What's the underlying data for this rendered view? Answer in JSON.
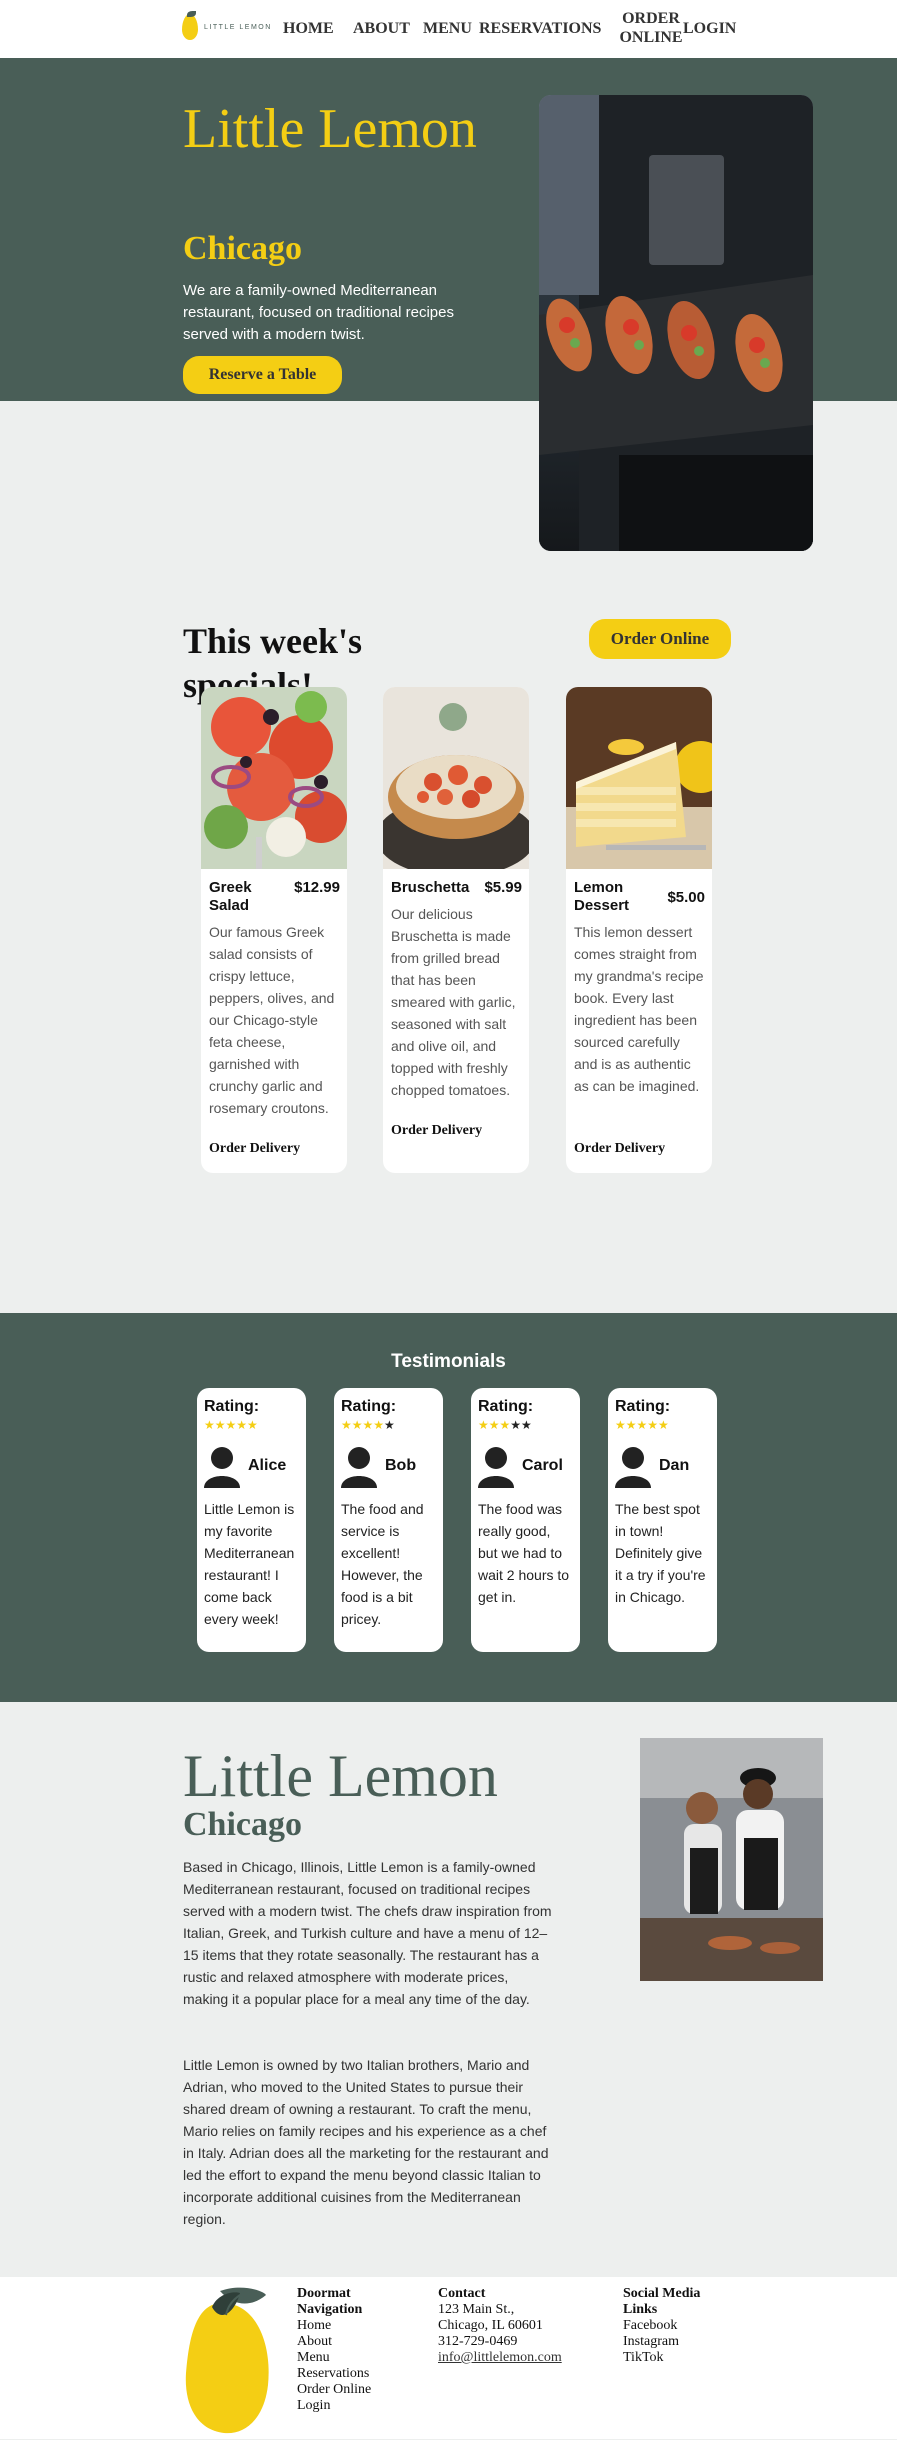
{
  "nav": {
    "logo_text": "LITTLE LEMON",
    "links": [
      {
        "label": "HOME"
      },
      {
        "label": "ABOUT"
      },
      {
        "label": "MENU"
      },
      {
        "label": "RESERVATIONS"
      },
      {
        "label": "ORDER ONLINE"
      },
      {
        "label": "LOGIN"
      }
    ]
  },
  "hero": {
    "title": "Little Lemon",
    "subtitle": "Chicago",
    "description": "We are a family-owned Mediterranean restaurant, focused on traditional recipes served with a modern twist.",
    "button": "Reserve a Table"
  },
  "specials": {
    "title": "This week's specials!",
    "order_button": "Order Online",
    "items": [
      {
        "name": "Greek Salad",
        "price": "$12.99",
        "description": "Our famous Greek salad consists of crispy lettuce, peppers, olives, and our Chicago-style feta cheese, garnished with crunchy garlic and rosemary croutons.",
        "action": "Order Delivery"
      },
      {
        "name": "Bruschetta",
        "price": "$5.99",
        "description": "Our delicious Bruschetta is made from grilled bread that has been smeared with garlic, seasoned with salt and olive oil, and topped with freshly chopped tomatoes.",
        "action": "Order Delivery"
      },
      {
        "name": "Lemon Dessert",
        "price": "$5.00",
        "description": "This lemon dessert comes straight from my grandma's recipe book. Every last ingredient has been sourced carefully and is as authentic as can be imagined.",
        "action": "Order Delivery"
      }
    ]
  },
  "testimonials": {
    "title": "Testimonials",
    "rating_label": "Rating:",
    "items": [
      {
        "name": "Alice",
        "rating": 5,
        "text": "Little Lemon is my favorite Mediterranean restaurant! I come back every week!"
      },
      {
        "name": "Bob",
        "rating": 4,
        "text": "The food and service is excellent! However, the food is a bit pricey."
      },
      {
        "name": "Carol",
        "rating": 3,
        "text": "The food was really good, but we had to wait 2 hours to get in."
      },
      {
        "name": "Dan",
        "rating": 5,
        "text": "The best spot in town! Definitely give it a try if you're in Chicago."
      }
    ]
  },
  "about": {
    "title": "Little Lemon",
    "subtitle": "Chicago",
    "paragraph1": "Based in Chicago, Illinois, Little Lemon is a family-owned Mediterranean restaurant, focused on traditional recipes served with a modern twist. The chefs draw inspiration from Italian, Greek, and Turkish culture and have a menu of 12–15 items that they rotate seasonally. The restaurant has a rustic and relaxed atmosphere with moderate prices, making it a popular place for a meal any time of the day.",
    "paragraph2": "Little Lemon is owned by two Italian brothers, Mario and Adrian, who moved to the United States to pursue their shared dream of owning a restaurant. To craft the menu, Mario relies on family recipes and his experience as a chef in Italy. Adrian does all the marketing for the restaurant and led the effort to expand the menu beyond classic Italian to incorporate additional cuisines from the Mediterranean region."
  },
  "footer": {
    "nav_title": "Doormat Navigation",
    "nav_items": [
      "Home",
      "About",
      "Menu",
      "Reservations",
      "Order Online",
      "Login"
    ],
    "contact_title": "Contact",
    "contact_address1": "123 Main St.,",
    "contact_address2": "Chicago, IL 60601",
    "contact_phone": "312-729-0469",
    "contact_email": "info@littlelemon.com",
    "social_title": "Social Media Links",
    "social_items": [
      "Facebook",
      "Instagram",
      "TikTok"
    ]
  },
  "colors": {
    "primary_green": "#495E57",
    "primary_yellow": "#F4CE14",
    "background": "#EDEFEE"
  }
}
